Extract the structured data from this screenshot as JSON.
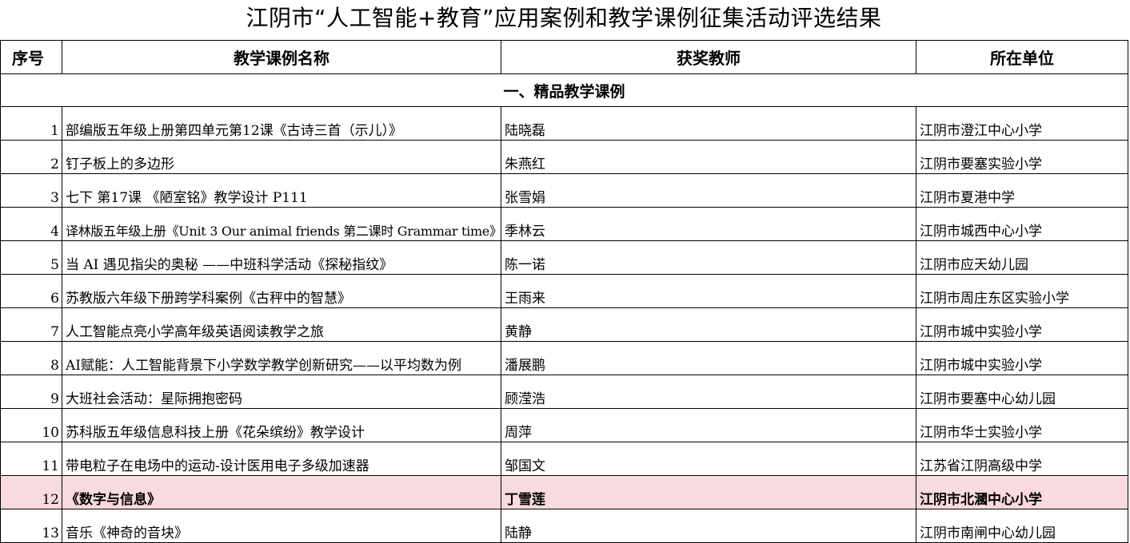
{
  "title": "江阴市“人工智能+教育”应用案例和教学课例征集活动评选结果",
  "table": {
    "headers": {
      "no": "序号",
      "name": "教学课例名称",
      "teacher": "获奖教师",
      "school": "所在单位"
    },
    "section": "一、精品教学课例",
    "rows": [
      {
        "no": "1",
        "name": "部编版五年级上册第四单元第12课《古诗三首（示儿）》",
        "teacher": "陆晓磊",
        "school": "江阴市澄江中心小学"
      },
      {
        "no": "2",
        "name": "钉子板上的多边形",
        "teacher": "朱燕红",
        "school": "江阴市要塞实验小学"
      },
      {
        "no": "3",
        "name": "七下 第17课 《陋室铭》教学设计  P111",
        "teacher": "张雪娟",
        "school": "江阴市夏港中学"
      },
      {
        "no": "4",
        "name": "译林版五年级上册《Unit 3 Our animal friends 第二课时 Grammar time》",
        "teacher": "季林云",
        "school": "江阴市城西中心小学"
      },
      {
        "no": "5",
        "name": "当 AI 遇见指尖的奥秘 ——中班科学活动《探秘指纹》",
        "teacher": "陈一诺",
        "school": "江阴市应天幼儿园"
      },
      {
        "no": "6",
        "name": "苏教版六年级下册跨学科案例《古秤中的智慧》",
        "teacher": "王雨来",
        "school": "江阴市周庄东区实验小学"
      },
      {
        "no": "7",
        "name": "人工智能点亮小学高年级英语阅读教学之旅",
        "teacher": "黄静",
        "school": "江阴市城中实验小学"
      },
      {
        "no": "8",
        "name": "AI赋能：人工智能背景下小学数学教学创新研究——以平均数为例",
        "teacher": "潘展鹏",
        "school": "江阴市城中实验小学"
      },
      {
        "no": "9",
        "name": "大班社会活动：星际拥抱密码",
        "teacher": "顾滢浩",
        "school": "江阴市要塞中心幼儿园"
      },
      {
        "no": "10",
        "name": "苏科版五年级信息科技上册《花朵缤纷》教学设计",
        "teacher": "周萍",
        "school": "江阴市华士实验小学"
      },
      {
        "no": "11",
        "name": "带电粒子在电场中的运动-设计医用电子多级加速器",
        "teacher": "邹国文",
        "school": "江苏省江阴高级中学"
      },
      {
        "no": "12",
        "name": "《数字与信息》",
        "teacher": "丁雪莲",
        "school": "江阴市北漍中心小学"
      },
      {
        "no": "13",
        "name": "音乐《神奇的音块》",
        "teacher": "陆静",
        "school": "江阴市南闸中心幼儿园"
      }
    ]
  },
  "colors": {
    "highlight_row": "#f9dade",
    "grid": "#000000"
  }
}
